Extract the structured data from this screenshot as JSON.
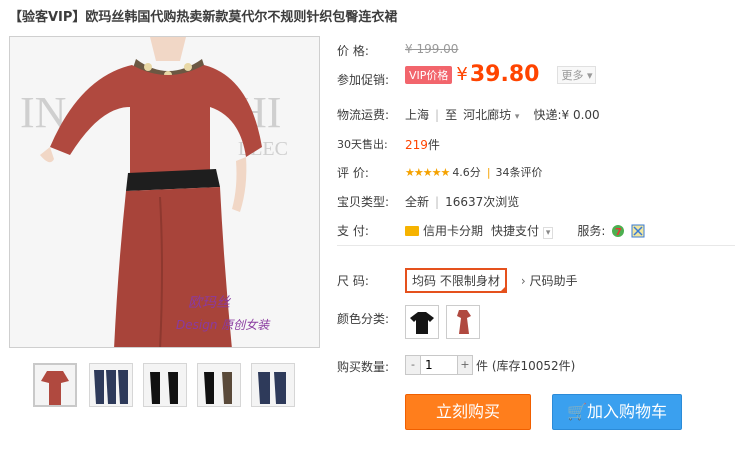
{
  "title": "【验客VIP】欧玛丝韩国代购热卖新款莫代尔不规则针织包臀连衣裙",
  "watermark": {
    "line1": "欧玛丝",
    "line2": "Design 原创女装"
  },
  "price": {
    "label": "价 格:",
    "original": "¥ 199.00"
  },
  "promo": {
    "label": "参加促销:",
    "badge": "VIP价格",
    "currency": "¥",
    "value": "39.80",
    "more": "更多"
  },
  "shipping": {
    "label": "物流运费:",
    "from": "上海",
    "to_sep": "至",
    "to": "河北廊坊",
    "method": "快递:",
    "fee": "¥ 0.00"
  },
  "sold": {
    "label": "30天售出:",
    "count": "219",
    "unit": "件"
  },
  "rating": {
    "label": "评 价:",
    "stars": "★★★★★",
    "score": "4.6分",
    "reviews": "34条评价"
  },
  "condition": {
    "label": "宝贝类型:",
    "type": "全新",
    "views": "16637次浏览"
  },
  "payment": {
    "label": "支 付:",
    "card": "信用卡分期",
    "quick": "快捷支付",
    "service_label": "服务:"
  },
  "size": {
    "label": "尺 码:",
    "option": "均码 不限制身材",
    "helper": "尺码助手"
  },
  "colors": {
    "label": "颜色分类:"
  },
  "quantity": {
    "label": "购买数量:",
    "minus": "-",
    "value": "1",
    "plus": "+",
    "stock": "件 (库存10052件)"
  },
  "actions": {
    "buy": "立刻购买",
    "cart": "加入购物车"
  },
  "theme": {
    "accent": "#ff4400",
    "buy_bg": "#ff7e1c",
    "cart_bg": "#3aa0ef",
    "dress_color": "#b0493f"
  }
}
